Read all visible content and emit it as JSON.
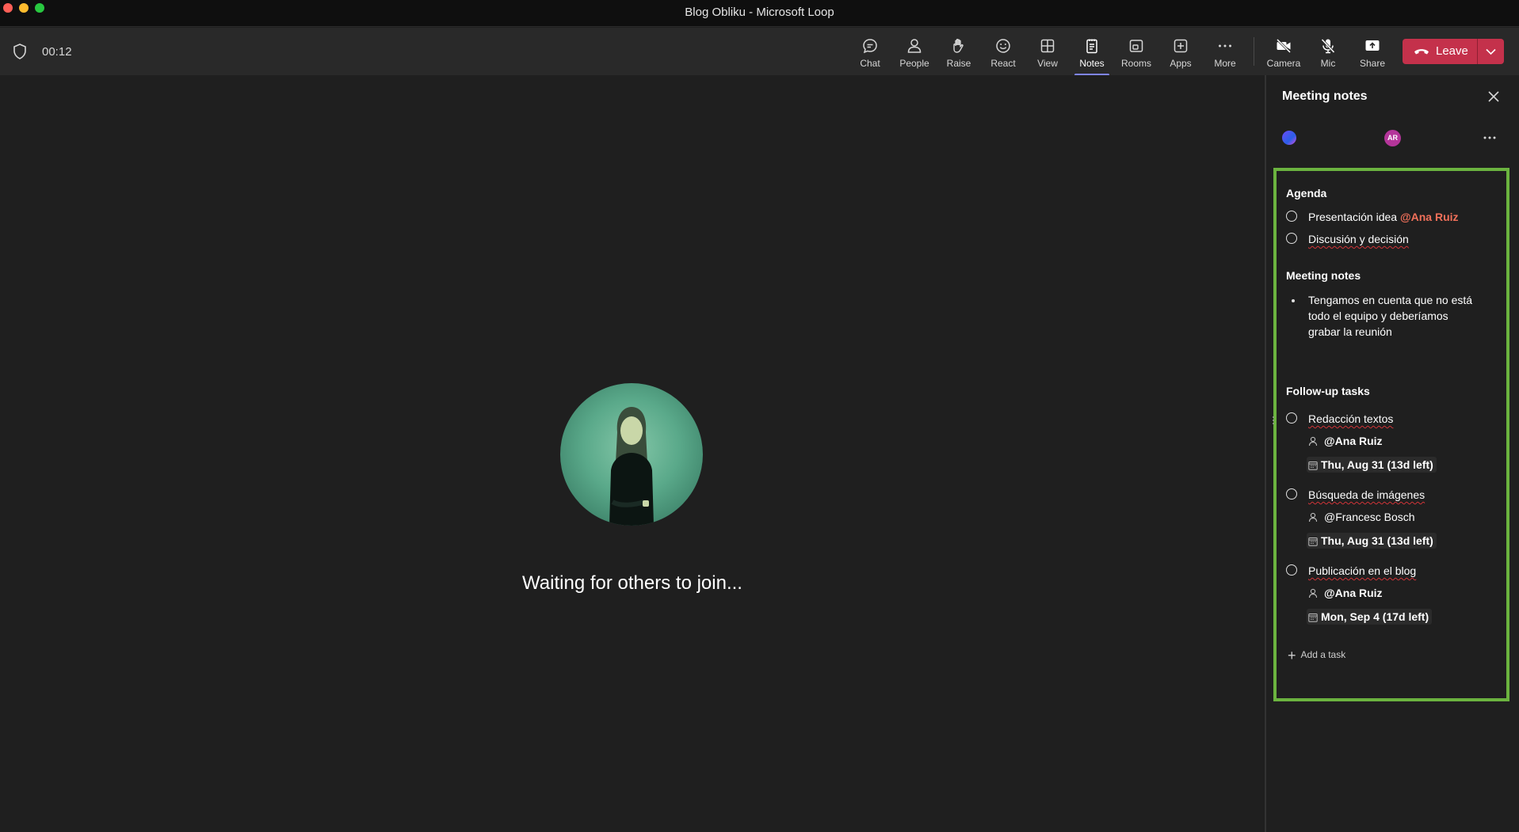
{
  "window": {
    "title": "Blog Obliku - Microsoft Loop"
  },
  "toolbar": {
    "timer": "00:12",
    "buttons": {
      "chat": "Chat",
      "people": "People",
      "raise": "Raise",
      "react": "React",
      "view": "View",
      "notes": "Notes",
      "rooms": "Rooms",
      "apps": "Apps",
      "more": "More",
      "camera": "Camera",
      "mic": "Mic",
      "share": "Share"
    },
    "active_tab": "Notes",
    "leave_label": "Leave",
    "colors": {
      "leave": "#c4314b",
      "active_indicator": "#7f85f5"
    }
  },
  "stage": {
    "status": "Waiting for others to join..."
  },
  "panel": {
    "title": "Meeting notes",
    "avatar_initials": "AR",
    "loop": {
      "agenda_heading": "Agenda",
      "agenda_items": [
        {
          "text": "Presentación idea ",
          "mention": "@Ana Ruiz"
        },
        {
          "text": "Discusión y decisión"
        }
      ],
      "notes_heading": "Meeting notes",
      "notes_bullets": [
        {
          "lines": [
            "Tengamos en cuenta que no está",
            "todo el equipo y deberíamos",
            "grabar la reunión"
          ]
        }
      ],
      "tasks_heading": "Follow-up tasks",
      "tasks": [
        {
          "title": "Redacción textos",
          "assignee": "@Ana Ruiz",
          "due": "Thu, Aug 31 (13d left)"
        },
        {
          "title": "Búsqueda de imágenes",
          "assignee": "@Francesc Bosch",
          "due": "Thu, Aug 31 (13d left)"
        },
        {
          "title": "Publicación en el blog",
          "assignee": "@Ana Ruiz",
          "due": "Mon, Sep 4 (17d left)"
        }
      ],
      "add_task_label": "Add a task",
      "colors": {
        "border": "#6bb33f",
        "mention_ana": "#f1705a",
        "mention_francesc": "#8c8ff0"
      }
    }
  }
}
